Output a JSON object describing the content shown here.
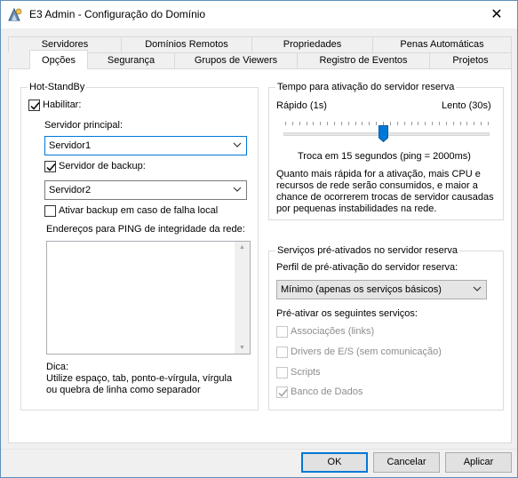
{
  "window": {
    "title": "E3 Admin - Configuração do Domínio",
    "close_glyph": "✕"
  },
  "tabs": {
    "row_top": [
      "Servidores",
      "Domínios Remotos",
      "Propriedades",
      "Penas Automáticas"
    ],
    "row_bottom": [
      "Opções",
      "Segurança",
      "Grupos de Viewers",
      "Registro de Eventos",
      "Projetos"
    ],
    "active": "Opções"
  },
  "hotstandby": {
    "title": "Hot-StandBy",
    "enable_label": "Habilitar:",
    "enable_checked": true,
    "primary_label": "Servidor principal:",
    "primary_value": "Servidor1",
    "backup_label": "Servidor de backup:",
    "backup_checked": true,
    "backup_value": "Servidor2",
    "failover_label": "Ativar backup em caso de falha local",
    "failover_checked": false,
    "ping_label": "Endereços para PING de integridade da rede:",
    "tip_title": "Dica:",
    "tip_line1": "Utilize espaço, tab, ponto-e-vírgula, vírgula",
    "tip_line2": "ou quebra de linha como separador"
  },
  "activation_time": {
    "title": "Tempo para ativação do servidor reserva",
    "fast_label": "Rápido (1s)",
    "slow_label": "Lento (30s)",
    "slider_value": 15,
    "slider_min": 1,
    "slider_max": 30,
    "exchange_text": "Troca em 15 segundos (ping = 2000ms)",
    "desc_line1": "Quanto mais rápida for a ativação, mais CPU e",
    "desc_line2": "recursos de rede serão consumidos, e maior a",
    "desc_line3": "chance de ocorrerem trocas de servidor causadas",
    "desc_line4": "por pequenas instabilidades na rede."
  },
  "preactivated": {
    "title": "Serviços pré-ativados no servidor reserva",
    "profile_label": "Perfil de pré-ativação do servidor reserva:",
    "profile_value": "Mínimo (apenas os serviços básicos)",
    "services_label": "Pré-ativar os seguintes serviços:",
    "services": [
      {
        "label": "Associações (links)",
        "checked": false
      },
      {
        "label": "Drivers de E/S (sem comunicação)",
        "checked": false
      },
      {
        "label": "Scripts",
        "checked": false
      },
      {
        "label": "Banco de Dados",
        "checked": true
      }
    ]
  },
  "buttons": {
    "ok": "OK",
    "cancel": "Cancelar",
    "apply": "Aplicar"
  },
  "colors": {
    "accent": "#0078d7",
    "disabled_text": "#8d8d8d"
  }
}
